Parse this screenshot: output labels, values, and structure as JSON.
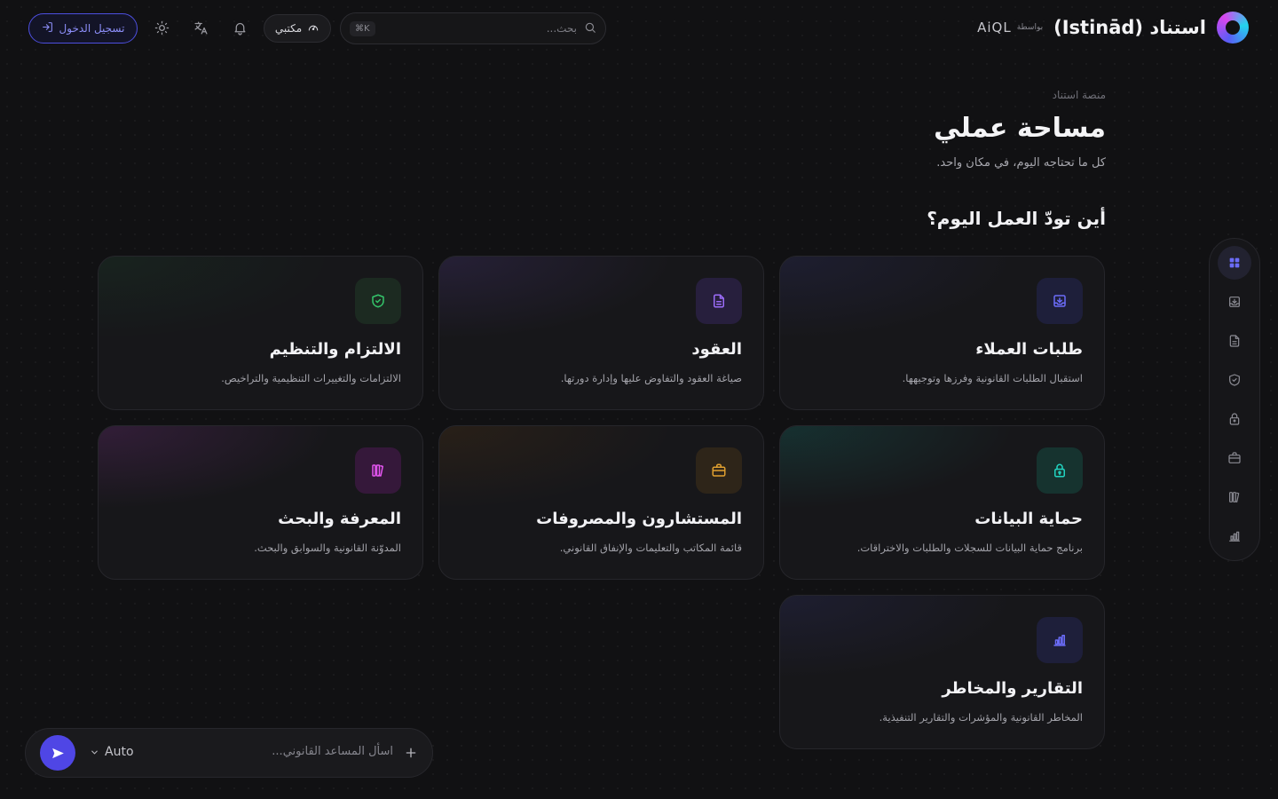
{
  "header": {
    "brand": {
      "name": "استناد (Istinād)",
      "by_label": "بواسطة",
      "aiql": "AiQL"
    },
    "search": {
      "placeholder": "بحث...",
      "shortcut": "⌘K"
    },
    "office_label": "مكتبي",
    "login_label": "تسجيل الدخول"
  },
  "intro": {
    "breadcrumb": "منصة استناد",
    "title": "مساحة عملي",
    "subtitle": "كل ما تحتاجه اليوم، في مكان واحد.",
    "section_question": "أين تودّ العمل اليوم؟"
  },
  "cards": [
    {
      "title": "طلبات العملاء",
      "desc": "استقبال الطلبات القانونية وفرزها وتوجيهها.",
      "icon": "inbox-download-icon",
      "accent": "#5b5cf6"
    },
    {
      "title": "العقود",
      "desc": "صياغة العقود والتفاوض عليها وإدارة دورتها.",
      "icon": "document-icon",
      "accent": "#8b5cf6"
    },
    {
      "title": "الالتزام والتنظيم",
      "desc": "الالتزامات والتغييرات التنظيمية والتراخيص.",
      "icon": "shield-check-icon",
      "accent": "#22c55e"
    },
    {
      "title": "حماية البيانات",
      "desc": "برنامج حماية البيانات للسجلات والطلبات والاختراقات.",
      "icon": "lock-icon",
      "accent": "#14b8a6"
    },
    {
      "title": "المستشارون والمصروفات",
      "desc": "قائمة المكاتب والتعليمات والإنفاق القانوني.",
      "icon": "briefcase-icon",
      "accent": "#d97706"
    },
    {
      "title": "المعرفة والبحث",
      "desc": "المدوّنة القانونية والسوابق والبحث.",
      "icon": "books-icon",
      "accent": "#d946ef"
    },
    {
      "title": "التقارير والمخاطر",
      "desc": "المخاطر القانونية والمؤشرات والتقارير التنفيذية.",
      "icon": "bar-chart-icon",
      "accent": "#5b5cf6"
    }
  ],
  "rail": {
    "items": [
      "grid-icon",
      "inbox-download-icon",
      "document-icon",
      "shield-check-icon",
      "lock-icon",
      "briefcase-icon",
      "books-icon",
      "bar-chart-icon"
    ],
    "active_index": 0
  },
  "composer": {
    "placeholder": "اسأل المساعد القانوني...",
    "model": "Auto"
  },
  "colors": {
    "background": "#111113",
    "primary": "#4f46e5",
    "card": "#17171a"
  }
}
